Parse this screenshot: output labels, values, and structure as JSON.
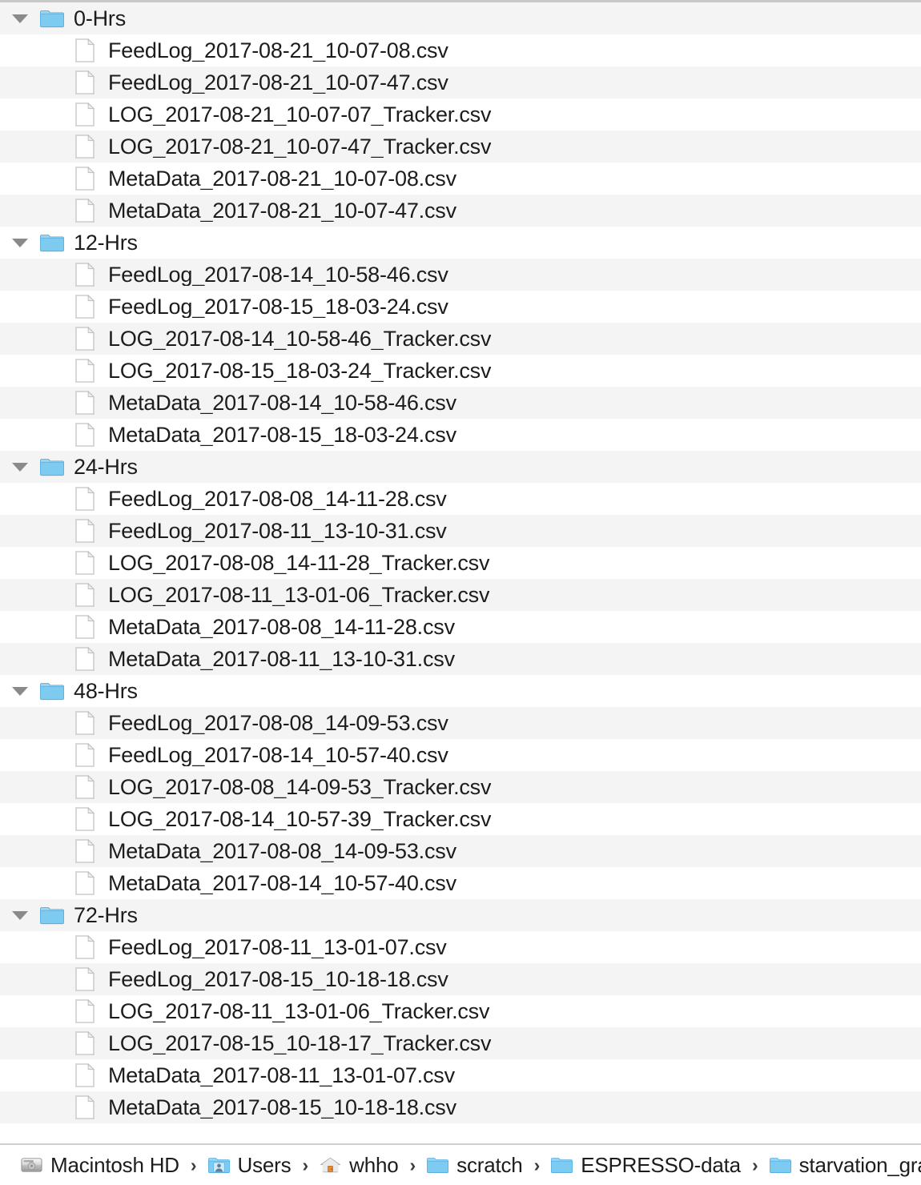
{
  "window": {
    "view": "list",
    "colors": {
      "stripe_gray": "#f4f4f4",
      "stripe_white": "#ffffff",
      "folder_blue": "#6fc2ef",
      "text": "#1c1c1c",
      "separator": "#c8c8c8"
    }
  },
  "groups": [
    {
      "folder": "0-Hrs",
      "expanded": true,
      "files": [
        "FeedLog_2017-08-21_10-07-08.csv",
        "FeedLog_2017-08-21_10-07-47.csv",
        "LOG_2017-08-21_10-07-07_Tracker.csv",
        "LOG_2017-08-21_10-07-47_Tracker.csv",
        "MetaData_2017-08-21_10-07-08.csv",
        "MetaData_2017-08-21_10-07-47.csv"
      ]
    },
    {
      "folder": "12-Hrs",
      "expanded": true,
      "files": [
        "FeedLog_2017-08-14_10-58-46.csv",
        "FeedLog_2017-08-15_18-03-24.csv",
        "LOG_2017-08-14_10-58-46_Tracker.csv",
        "LOG_2017-08-15_18-03-24_Tracker.csv",
        "MetaData_2017-08-14_10-58-46.csv",
        "MetaData_2017-08-15_18-03-24.csv"
      ]
    },
    {
      "folder": "24-Hrs",
      "expanded": true,
      "files": [
        "FeedLog_2017-08-08_14-11-28.csv",
        "FeedLog_2017-08-11_13-10-31.csv",
        "LOG_2017-08-08_14-11-28_Tracker.csv",
        "LOG_2017-08-11_13-01-06_Tracker.csv",
        "MetaData_2017-08-08_14-11-28.csv",
        "MetaData_2017-08-11_13-10-31.csv"
      ]
    },
    {
      "folder": "48-Hrs",
      "expanded": true,
      "files": [
        "FeedLog_2017-08-08_14-09-53.csv",
        "FeedLog_2017-08-14_10-57-40.csv",
        "LOG_2017-08-08_14-09-53_Tracker.csv",
        "LOG_2017-08-14_10-57-39_Tracker.csv",
        "MetaData_2017-08-08_14-09-53.csv",
        "MetaData_2017-08-14_10-57-40.csv"
      ]
    },
    {
      "folder": "72-Hrs",
      "expanded": true,
      "files": [
        "FeedLog_2017-08-11_13-01-07.csv",
        "FeedLog_2017-08-15_10-18-18.csv",
        "LOG_2017-08-11_13-01-06_Tracker.csv",
        "LOG_2017-08-15_10-18-17_Tracker.csv",
        "MetaData_2017-08-11_13-01-07.csv",
        "MetaData_2017-08-15_10-18-18.csv"
      ]
    }
  ],
  "path_bar": {
    "separator": "›",
    "crumbs": [
      {
        "label": "Macintosh HD",
        "icon": "hard-drive-icon"
      },
      {
        "label": "Users",
        "icon": "users-folder-icon"
      },
      {
        "label": "whho",
        "icon": "home-folder-icon"
      },
      {
        "label": "scratch",
        "icon": "folder-icon"
      },
      {
        "label": "ESPRESSO-data",
        "icon": "folder-icon"
      },
      {
        "label": "starvation_gradient",
        "icon": "folder-icon"
      }
    ]
  }
}
